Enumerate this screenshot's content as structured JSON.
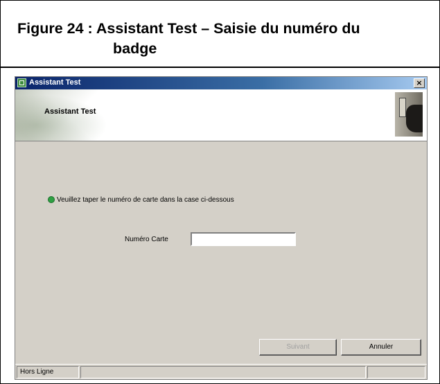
{
  "caption": {
    "line1": "Figure 24 : Assistant Test – Saisie du numéro du",
    "line2": "badge"
  },
  "window": {
    "title": "Assistant Test",
    "close_label": "×",
    "icon": "app-icon"
  },
  "header": {
    "title": "Assistant Test",
    "photo": "badge-reader-photo"
  },
  "form": {
    "instruction": "Veuillez taper le numéro de carte dans la case ci-dessous",
    "instruction_icon": "green-bullet-icon",
    "card_label": "Numéro Carte",
    "card_value": ""
  },
  "buttons": {
    "next_label": "Suivant",
    "cancel_label": "Annuler"
  },
  "status": {
    "connection": "Hors Ligne",
    "middle": "",
    "right": ""
  },
  "colors": {
    "titlebar": "#0a246a",
    "window_bg": "#d4d0c8",
    "bullet": "#2ea043"
  }
}
